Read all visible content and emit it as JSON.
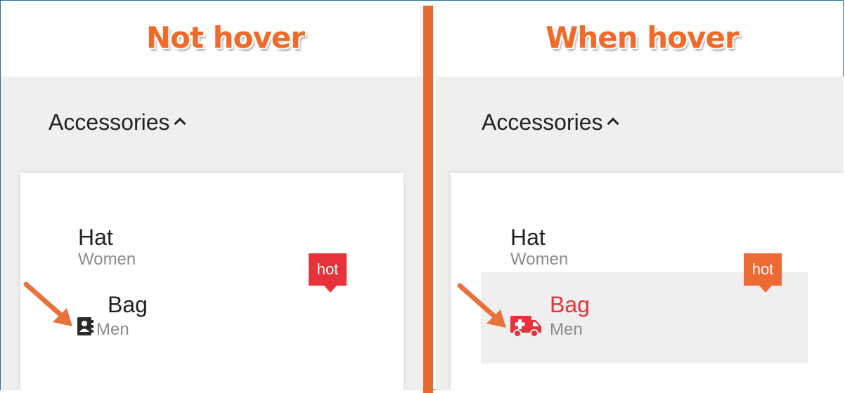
{
  "left_panel": {
    "caption": "Not hover",
    "menu": {
      "title": "Accessories"
    },
    "items": [
      {
        "label": "Hat",
        "sublabel": "Women"
      },
      {
        "label": "Bag",
        "sublabel": "Men",
        "icon": "address-book-icon"
      }
    ],
    "badge": {
      "text": "hot",
      "color": "#e8323c"
    }
  },
  "right_panel": {
    "caption": "When hover",
    "menu": {
      "title": "Accessories"
    },
    "items": [
      {
        "label": "Hat",
        "sublabel": "Women"
      },
      {
        "label": "Bag",
        "sublabel": "Men",
        "icon": "ambulance-icon",
        "hover_color": "#e8323c"
      }
    ],
    "badge": {
      "text": "hot",
      "color": "#ef6a32"
    }
  },
  "colors": {
    "caption": "#f26a2a",
    "divider": "#e66a2e",
    "arrow": "#e8733a",
    "hover_background": "#efefef",
    "frame_border": "#1f6f9c"
  }
}
